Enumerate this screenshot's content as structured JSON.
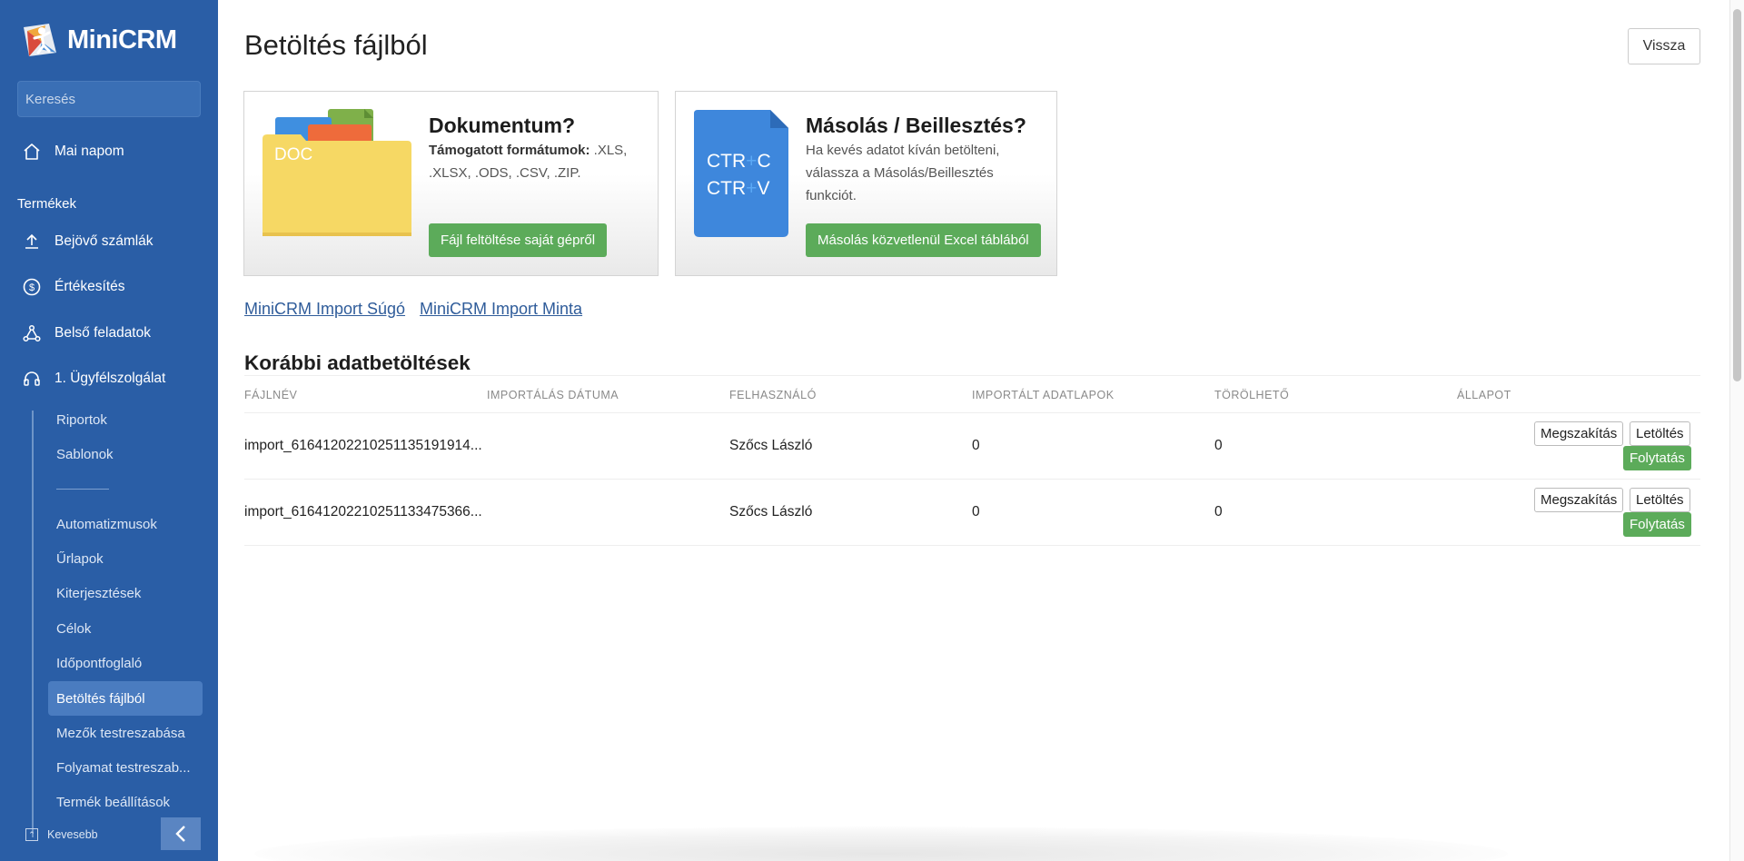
{
  "sidebar": {
    "logo_text": "MiniCRM",
    "search_placeholder": "Keresés",
    "top_item": "Mai napom",
    "section_label": "Termékek",
    "items": [
      {
        "label": "Bejövő számlák",
        "icon": "upload-icon"
      },
      {
        "label": "Értékesítés",
        "icon": "dollar-circle-icon"
      },
      {
        "label": "Belső feladatok",
        "icon": "network-icon"
      },
      {
        "label": "1. Ügyfélszolgálat",
        "icon": "headset-icon"
      }
    ],
    "sub_items": [
      "Riportok",
      "Sablonok",
      "Automatizmusok",
      "Űrlapok",
      "Kiterjesztések",
      "Célok",
      "Időpontfoglaló",
      "Betöltés fájlból",
      "Mezők testreszabása",
      "Folyamat testreszab...",
      "Termék beállítások"
    ],
    "active_sub_item": "Betöltés fájlból",
    "footer_label": "Kevesebb"
  },
  "header": {
    "title": "Betöltés fájlból",
    "back_label": "Vissza"
  },
  "cards": {
    "document": {
      "icon_label": "DOC",
      "title": "Dokumentum?",
      "formats_label": "Támogatott formátumok:",
      "formats": " .XLS, .XLSX, .ODS, .CSV, .ZIP.",
      "button": "Fájl feltöltése saját gépről"
    },
    "paste": {
      "icon_line1_a": "CTR",
      "icon_line1_plus": "+",
      "icon_line1_b": "C",
      "icon_line2_a": "CTR",
      "icon_line2_plus": "+",
      "icon_line2_b": "V",
      "title": "Másolás / Beillesztés?",
      "description": "Ha kevés adatot kíván betölteni, válassza a Másolás/Beillesztés funkciót.",
      "button": "Másolás közvetlenül Excel táblából"
    }
  },
  "links": {
    "help": "MiniCRM Import Súgó",
    "sample": "MiniCRM Import Minta"
  },
  "imports": {
    "title": "Korábbi adatbetöltések",
    "columns": [
      "FÁJLNÉV",
      "IMPORTÁLÁS DÁTUMA",
      "FELHASZNÁLÓ",
      "IMPORTÁLT ADATLAPOK",
      "TÖRÖLHETŐ",
      "ÁLLAPOT"
    ],
    "rows": [
      {
        "filename": "import_616412022102511351919​14...",
        "date": "",
        "user": "Szőcs László",
        "imported": "0",
        "deletable": "0"
      },
      {
        "filename": "import_6164120221025113347536​6...",
        "date": "",
        "user": "Szőcs László",
        "imported": "0",
        "deletable": "0"
      }
    ],
    "actions": {
      "cancel": "Megszakítás",
      "download": "Letöltés",
      "continue": "Folytatás"
    }
  },
  "colors": {
    "sidebar": "#2a5ea6",
    "accent_green": "#5cab5a",
    "link": "#2f5c9a"
  }
}
